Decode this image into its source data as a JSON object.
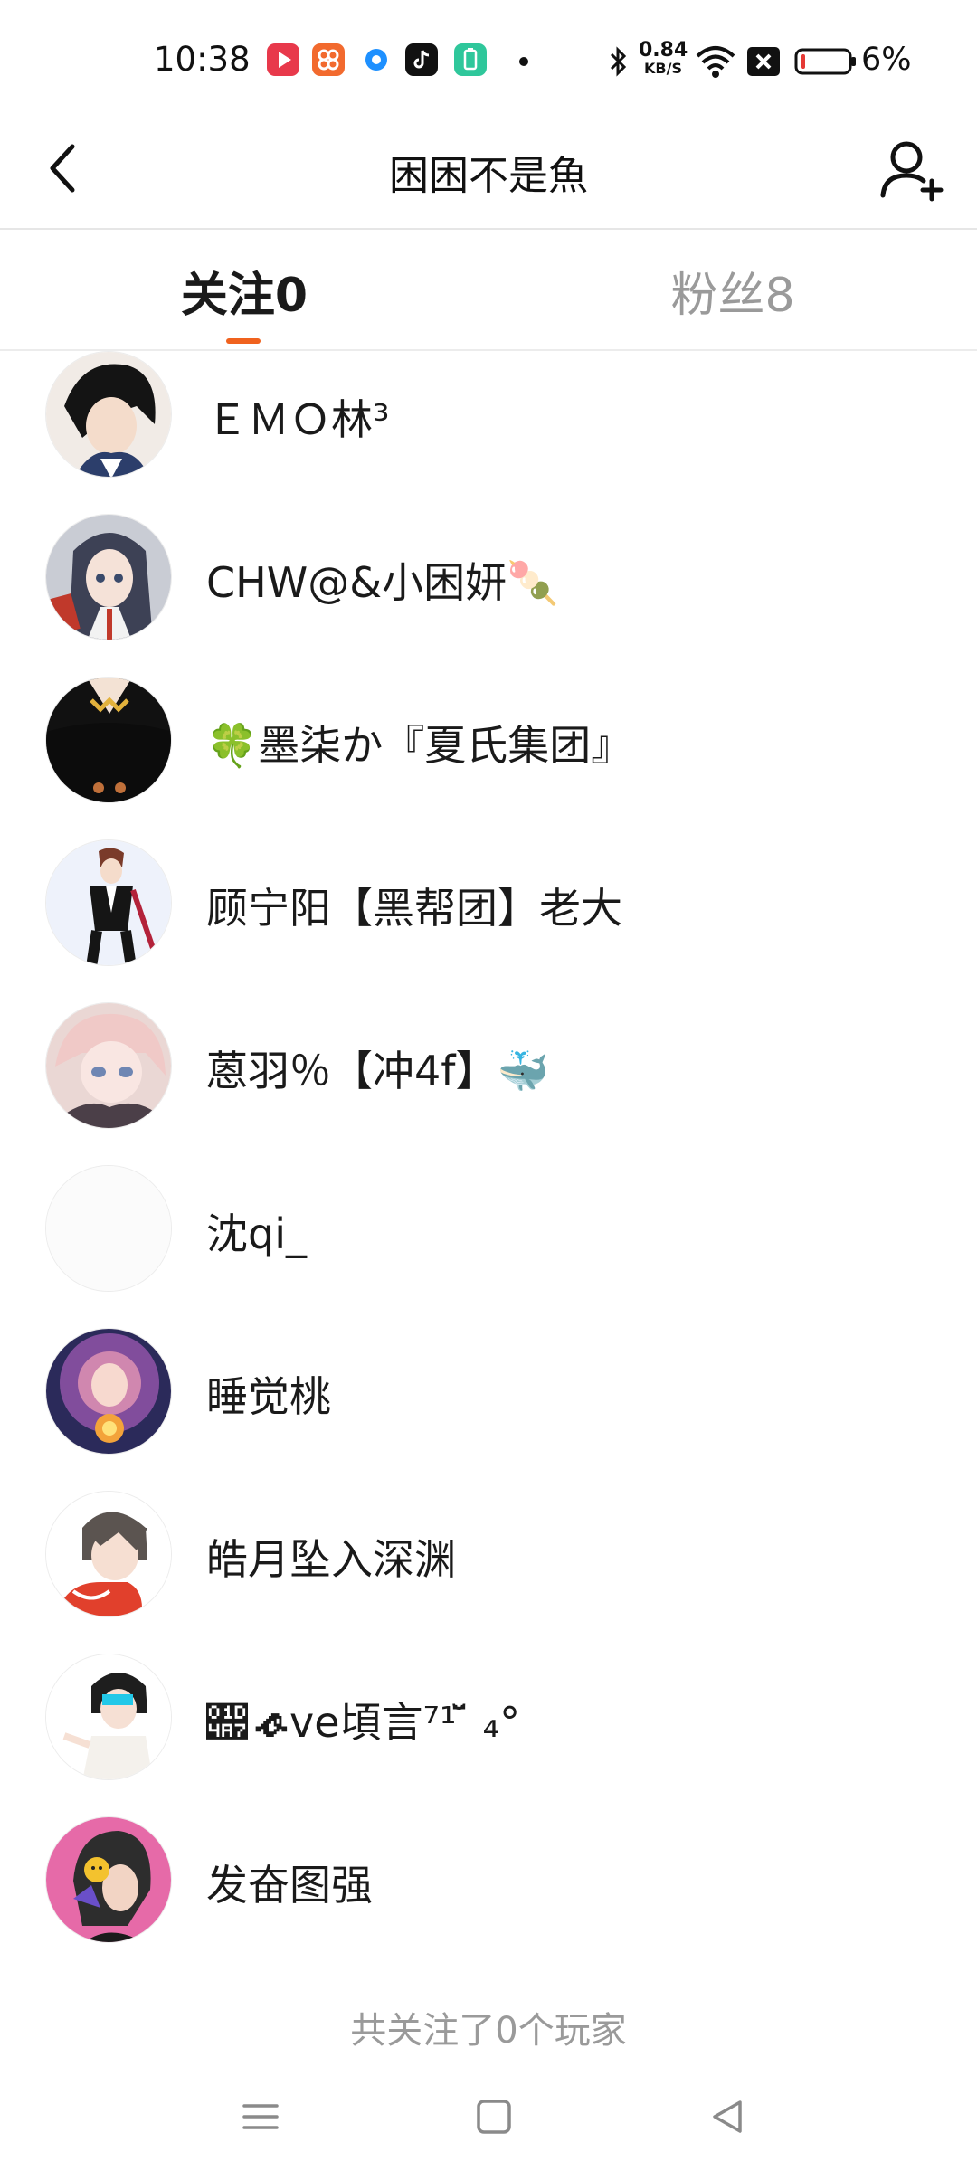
{
  "status_bar": {
    "time": "10:38",
    "net_speed_value": "0.84",
    "net_speed_unit": "KB/S",
    "battery_percent": "6%",
    "app_icons": [
      "video-app-icon",
      "store-app-icon",
      "browser-app-icon",
      "tiktok-app-icon",
      "battery-app-icon"
    ]
  },
  "header": {
    "title": "困困不是魚"
  },
  "tabs": [
    {
      "label": "关注0",
      "active": true
    },
    {
      "label": "粉丝8",
      "active": false
    }
  ],
  "follow_list": [
    {
      "name": "ＥＭＯ林³"
    },
    {
      "name": "CHW@&小困妍🍡"
    },
    {
      "name": "🍀墨柒か『夏氏集团』"
    },
    {
      "name": "顾宁阳【黑帮团】老大"
    },
    {
      "name": "蒽羽％【冲4f】🐳"
    },
    {
      "name": "沈qi_"
    },
    {
      "name": "睡觉桃"
    },
    {
      "name": "皓月坠入深渊"
    },
    {
      "name": "𝒧𝓸ve頃言⁷¹ ̆̈ ₄°"
    },
    {
      "name": "发奋图强"
    }
  ],
  "footer": {
    "summary": "共关注了0个玩家"
  },
  "colors": {
    "accent": "#f0621e",
    "inactive_tab": "#9a9a9a",
    "text": "#1a1a1a"
  }
}
